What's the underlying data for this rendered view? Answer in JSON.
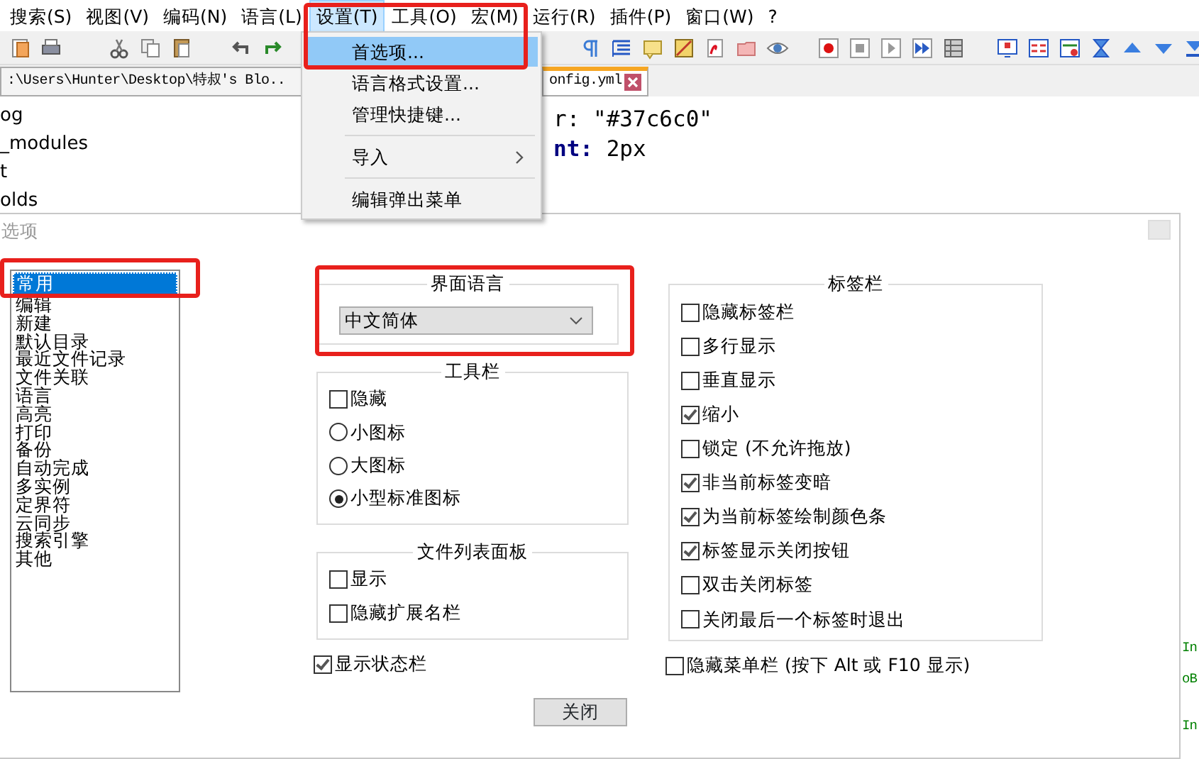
{
  "menu_bar": [
    {
      "label": "搜索(S)",
      "selected": false
    },
    {
      "label": "视图(V)",
      "selected": false
    },
    {
      "label": "编码(N)",
      "selected": false
    },
    {
      "label": "语言(L)",
      "selected": false
    },
    {
      "label": "设置(T)",
      "selected": true
    },
    {
      "label": "工具(O)",
      "selected": false
    },
    {
      "label": "宏(M)",
      "selected": false
    },
    {
      "label": "运行(R)",
      "selected": false
    },
    {
      "label": "插件(P)",
      "selected": false
    },
    {
      "label": "窗口(W)",
      "selected": false
    },
    {
      "label": "?",
      "selected": false
    }
  ],
  "open_menu": {
    "items": [
      {
        "kind": "item",
        "label": "首选项...",
        "selected": true
      },
      {
        "kind": "item",
        "label": "语言格式设置...",
        "selected": false
      },
      {
        "kind": "item",
        "label": "管理快捷键...",
        "selected": false
      },
      {
        "kind": "separator"
      },
      {
        "kind": "submenu",
        "label": "导入",
        "selected": false
      },
      {
        "kind": "separator"
      },
      {
        "kind": "item",
        "label": "编辑弹出菜单",
        "selected": false
      }
    ]
  },
  "tabs": [
    {
      "label": ":\\Users\\Hunter\\Desktop\\特叔's Blo..",
      "selected": false
    },
    {
      "label": "onfig.yml",
      "selected": true
    }
  ],
  "file_tree": [
    "og",
    "_modules",
    "t",
    "olds"
  ],
  "editor_lines": [
    "r: \"#37c6c0\"",
    "**nt:** 2px"
  ],
  "editor_edge_fragments": [
    "In",
    "oB",
    "In"
  ],
  "dialog": {
    "title": "选项",
    "categories": [
      {
        "label": "常用",
        "selected": true
      },
      {
        "label": "编辑",
        "selected": false
      },
      {
        "label": "新建",
        "selected": false
      },
      {
        "label": "默认目录",
        "selected": false
      },
      {
        "label": "最近文件记录",
        "selected": false
      },
      {
        "label": "文件关联",
        "selected": false
      },
      {
        "label": "语言",
        "selected": false
      },
      {
        "label": "高亮",
        "selected": false
      },
      {
        "label": "打印",
        "selected": false
      },
      {
        "label": "备份",
        "selected": false
      },
      {
        "label": "自动完成",
        "selected": false
      },
      {
        "label": "多实例",
        "selected": false
      },
      {
        "label": "定界符",
        "selected": false
      },
      {
        "label": "云同步",
        "selected": false
      },
      {
        "label": "搜索引擎",
        "selected": false
      },
      {
        "label": "其他",
        "selected": false
      }
    ],
    "language_group": {
      "title": "界面语言",
      "value": "中文简体"
    },
    "toolbar_group": {
      "title": "工具栏",
      "items": [
        {
          "kind": "checkbox",
          "label": "隐藏",
          "checked": false
        },
        {
          "kind": "radio",
          "label": "小图标",
          "selected": false
        },
        {
          "kind": "radio",
          "label": "大图标",
          "selected": false
        },
        {
          "kind": "radio",
          "label": "小型标准图标",
          "selected": true
        }
      ]
    },
    "file_list_group": {
      "title": "文件列表面板",
      "items": [
        {
          "kind": "checkbox",
          "label": "显示",
          "checked": false
        },
        {
          "kind": "checkbox",
          "label": "隐藏扩展名栏",
          "checked": false
        }
      ]
    },
    "status_bar_option": {
      "label": "显示状态栏",
      "checked": true
    },
    "tab_bar_group": {
      "title": "标签栏",
      "items": [
        {
          "kind": "checkbox",
          "label": "隐藏标签栏",
          "checked": false
        },
        {
          "kind": "checkbox",
          "label": "多行显示",
          "checked": false
        },
        {
          "kind": "checkbox",
          "label": "垂直显示",
          "checked": false
        },
        {
          "kind": "checkbox",
          "label": "缩小",
          "checked": true
        },
        {
          "kind": "checkbox",
          "label": "锁定 (不允许拖放)",
          "checked": false
        },
        {
          "kind": "checkbox",
          "label": "非当前标签变暗",
          "checked": true
        },
        {
          "kind": "checkbox",
          "label": "为当前标签绘制颜色条",
          "checked": true
        },
        {
          "kind": "checkbox",
          "label": "标签显示关闭按钮",
          "checked": true
        },
        {
          "kind": "checkbox",
          "label": "双击关闭标签",
          "checked": false
        },
        {
          "kind": "checkbox",
          "label": "关闭最后一个标签时退出",
          "checked": false
        }
      ]
    },
    "menu_bar_option": {
      "label": "隐藏菜单栏 (按下 Alt 或 F10 显示)",
      "checked": false
    },
    "close_button": "关闭"
  }
}
